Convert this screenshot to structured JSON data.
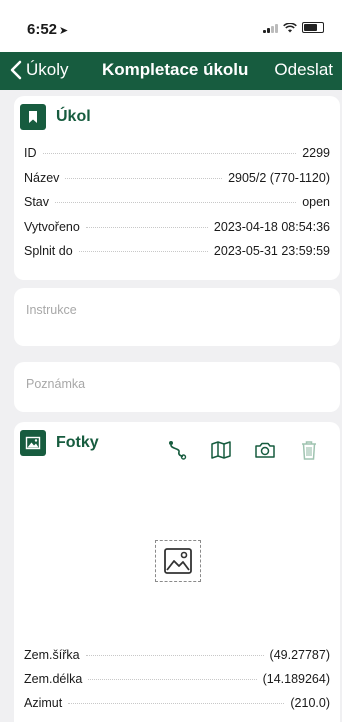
{
  "status_bar": {
    "time": "6:52",
    "location_arrow": "➤"
  },
  "nav": {
    "back_label": "Úkoly",
    "title": "Kompletace úkolu",
    "action": "Odeslat"
  },
  "task": {
    "title": "Úkol",
    "icon": "bookmark-icon",
    "rows": [
      {
        "label": "ID",
        "value": "2299"
      },
      {
        "label": "Název",
        "value": "2905/2 (770-1120)"
      },
      {
        "label": "Stav",
        "value": "open"
      },
      {
        "label": "Vytvořeno",
        "value": "2023-04-18 08:54:36"
      },
      {
        "label": "Splnit do",
        "value": "2023-05-31 23:59:59"
      }
    ]
  },
  "instructions": {
    "placeholder": "Instrukce"
  },
  "note": {
    "placeholder": "Poznámka"
  },
  "photos": {
    "title": "Fotky",
    "icon": "photo-icon",
    "tools": [
      "route-icon",
      "map-icon",
      "camera-icon",
      "trash-icon"
    ],
    "rows": [
      {
        "label": "Zem.šířka",
        "value": "(49.27787)"
      },
      {
        "label": "Zem.délka",
        "value": "(14.189264)"
      },
      {
        "label": "Azimut",
        "value": "(210.0)"
      }
    ]
  },
  "colors": {
    "accent": "#175c3f",
    "background": "#f0f0f2",
    "placeholder": "#a8a8a8"
  }
}
